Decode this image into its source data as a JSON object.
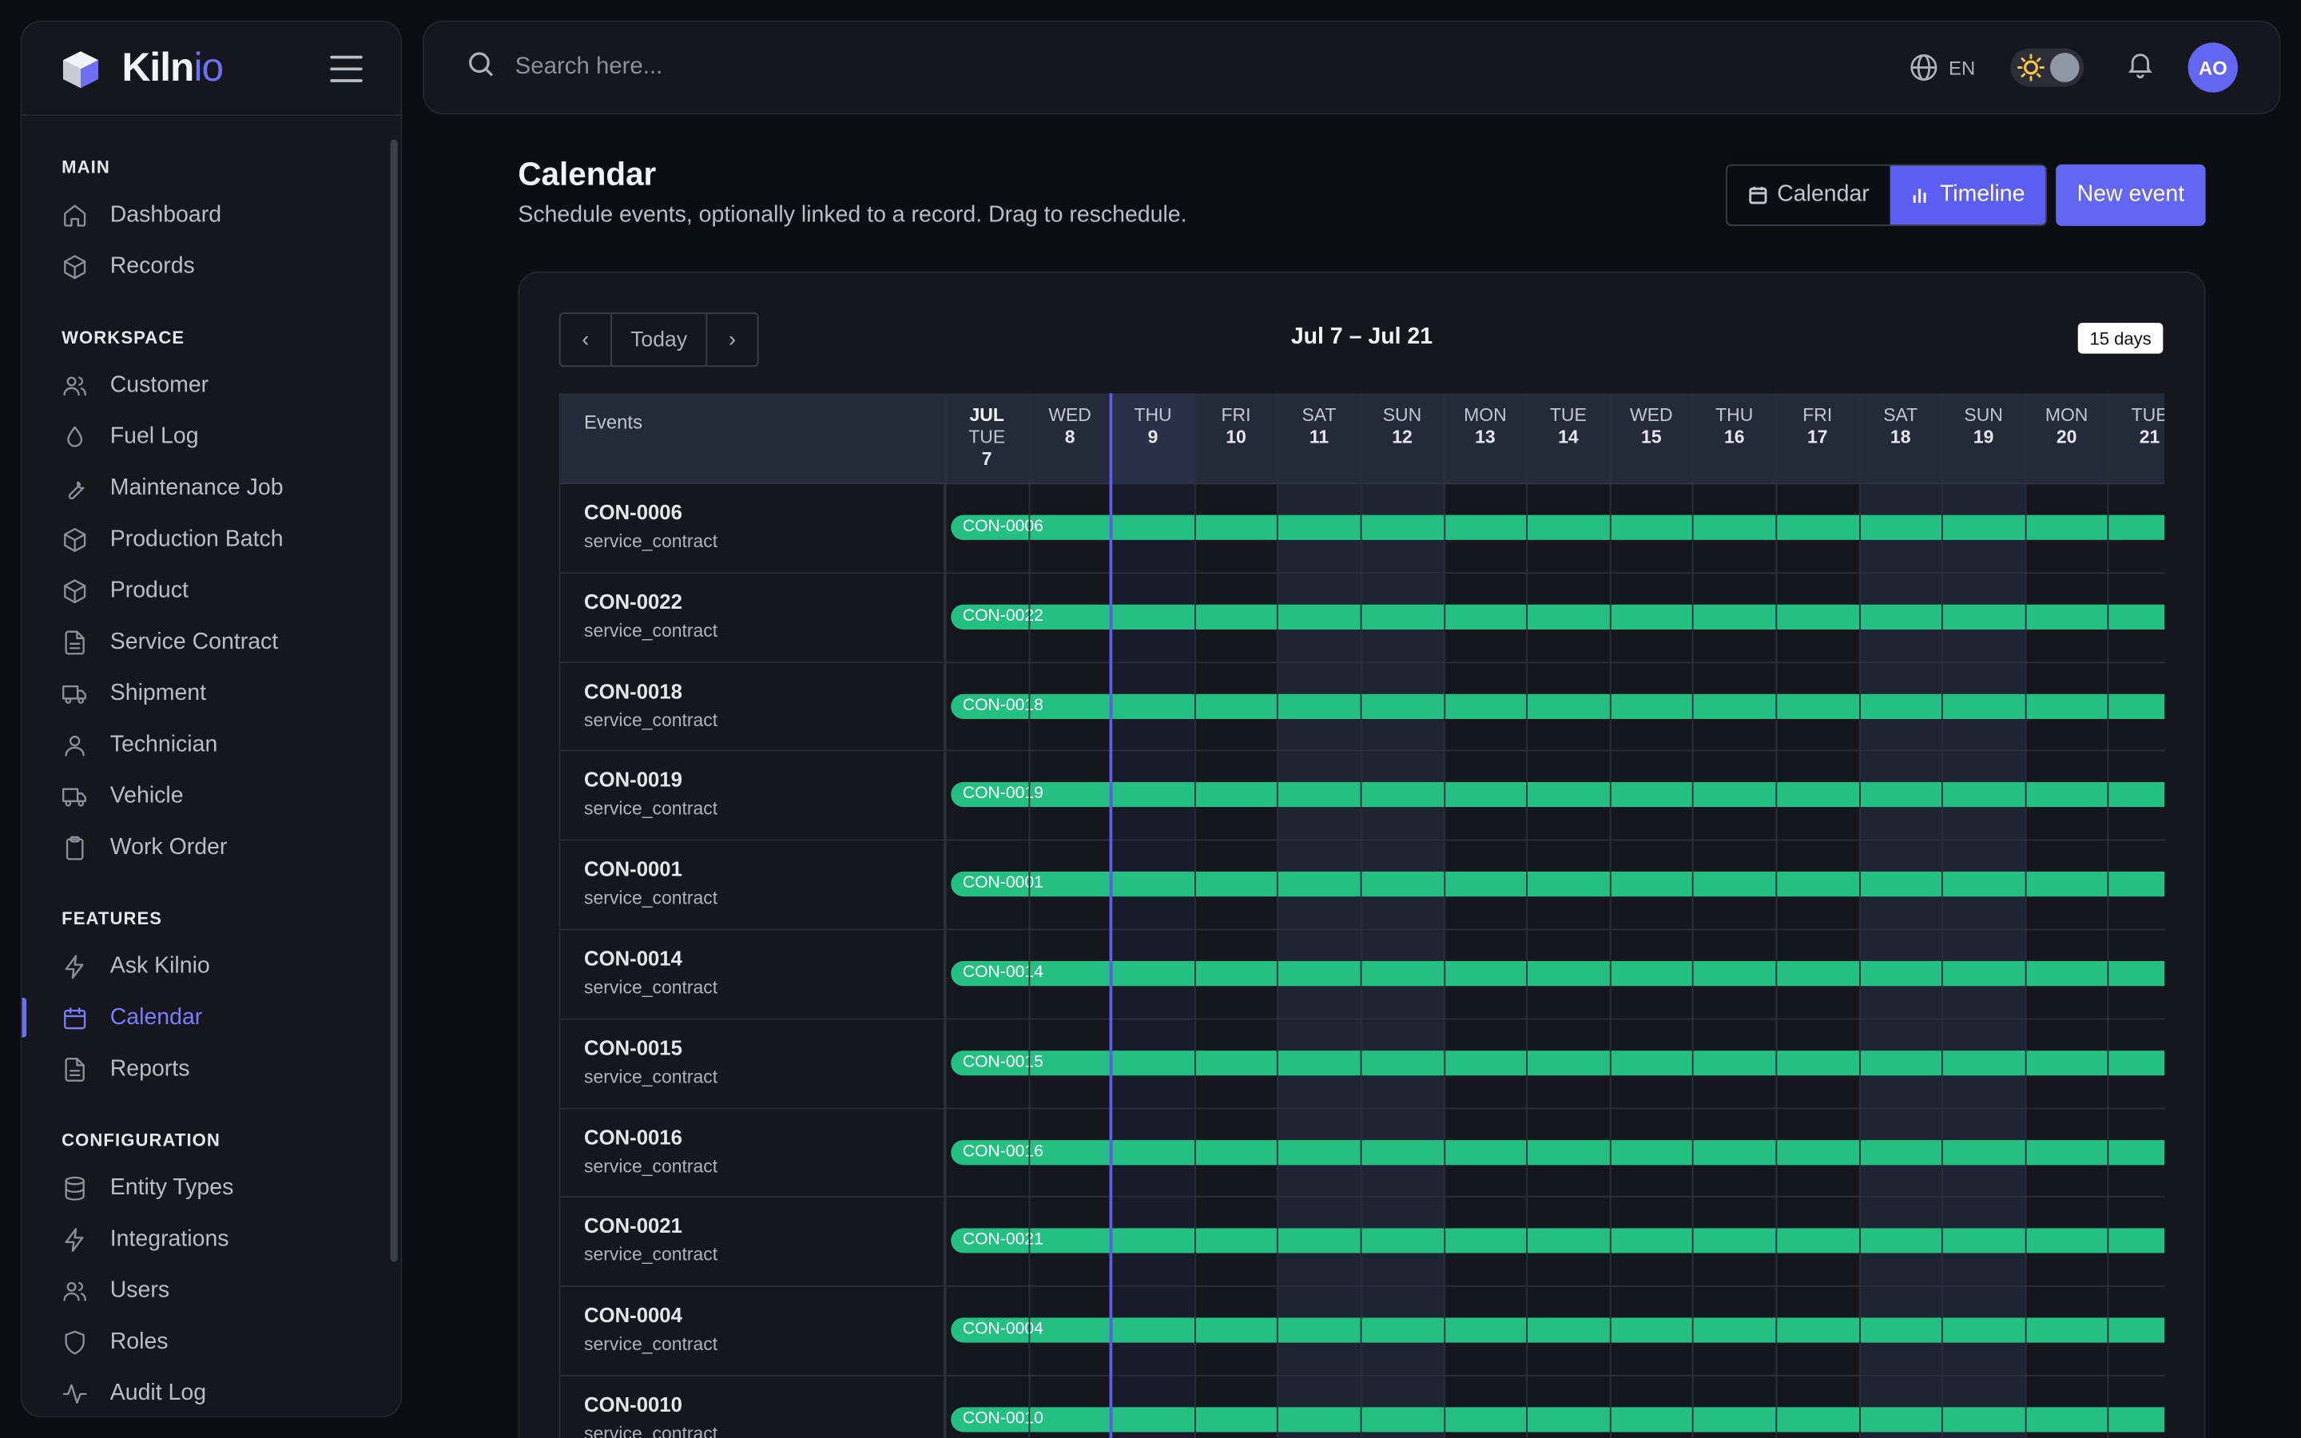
{
  "brand": {
    "name_main": "Kiln",
    "name_accent": "io"
  },
  "sidebar": {
    "sections": [
      {
        "title": "MAIN",
        "items": [
          {
            "label": "Dashboard",
            "icon": "home-icon"
          },
          {
            "label": "Records",
            "icon": "box-icon"
          }
        ]
      },
      {
        "title": "WORKSPACE",
        "items": [
          {
            "label": "Customer",
            "icon": "users-icon"
          },
          {
            "label": "Fuel Log",
            "icon": "droplet-icon"
          },
          {
            "label": "Maintenance Job",
            "icon": "wrench-icon"
          },
          {
            "label": "Production Batch",
            "icon": "box-icon"
          },
          {
            "label": "Product",
            "icon": "box-icon"
          },
          {
            "label": "Service Contract",
            "icon": "file-icon"
          },
          {
            "label": "Shipment",
            "icon": "truck-icon"
          },
          {
            "label": "Technician",
            "icon": "user-icon"
          },
          {
            "label": "Vehicle",
            "icon": "truck-icon"
          },
          {
            "label": "Work Order",
            "icon": "clipboard-icon"
          }
        ]
      },
      {
        "title": "FEATURES",
        "items": [
          {
            "label": "Ask Kilnio",
            "icon": "zap-icon"
          },
          {
            "label": "Calendar",
            "icon": "calendar-icon",
            "active": true
          },
          {
            "label": "Reports",
            "icon": "file-icon"
          }
        ]
      },
      {
        "title": "CONFIGURATION",
        "items": [
          {
            "label": "Entity Types",
            "icon": "database-icon"
          },
          {
            "label": "Integrations",
            "icon": "zap-icon"
          },
          {
            "label": "Users",
            "icon": "users-icon"
          },
          {
            "label": "Roles",
            "icon": "shield-icon"
          },
          {
            "label": "Audit Log",
            "icon": "activity-icon"
          }
        ]
      }
    ]
  },
  "topbar": {
    "search_placeholder": "Search here...",
    "language": "EN",
    "avatar_initials": "AO"
  },
  "page": {
    "title": "Calendar",
    "subtitle": "Schedule events, optionally linked to a record. Drag to reschedule.",
    "view_calendar": "Calendar",
    "view_timeline": "Timeline",
    "new_event": "New event"
  },
  "timeline": {
    "prev": "‹",
    "today": "Today",
    "next": "›",
    "range": "Jul 7 – Jul 21",
    "days_badge": "15 days",
    "events_header": "Events",
    "columns": [
      {
        "month": "JUL",
        "dow": "TUE",
        "day": "7"
      },
      {
        "dow": "WED",
        "day": "8"
      },
      {
        "dow": "THU",
        "day": "9",
        "today": true
      },
      {
        "dow": "FRI",
        "day": "10"
      },
      {
        "dow": "SAT",
        "day": "11",
        "weekend": true
      },
      {
        "dow": "SUN",
        "day": "12",
        "weekend": true
      },
      {
        "dow": "MON",
        "day": "13"
      },
      {
        "dow": "TUE",
        "day": "14"
      },
      {
        "dow": "WED",
        "day": "15"
      },
      {
        "dow": "THU",
        "day": "16"
      },
      {
        "dow": "FRI",
        "day": "17"
      },
      {
        "dow": "SAT",
        "day": "18",
        "weekend": true
      },
      {
        "dow": "SUN",
        "day": "19",
        "weekend": true
      },
      {
        "dow": "MON",
        "day": "20"
      },
      {
        "dow": "TUE",
        "day": "21"
      }
    ],
    "rows": [
      {
        "title": "CON-0006",
        "type": "service_contract",
        "bar": "CON-0006"
      },
      {
        "title": "CON-0022",
        "type": "service_contract",
        "bar": "CON-0022"
      },
      {
        "title": "CON-0018",
        "type": "service_contract",
        "bar": "CON-0018"
      },
      {
        "title": "CON-0019",
        "type": "service_contract",
        "bar": "CON-0019"
      },
      {
        "title": "CON-0001",
        "type": "service_contract",
        "bar": "CON-0001"
      },
      {
        "title": "CON-0014",
        "type": "service_contract",
        "bar": "CON-0014"
      },
      {
        "title": "CON-0015",
        "type": "service_contract",
        "bar": "CON-0015"
      },
      {
        "title": "CON-0016",
        "type": "service_contract",
        "bar": "CON-0016"
      },
      {
        "title": "CON-0021",
        "type": "service_contract",
        "bar": "CON-0021"
      },
      {
        "title": "CON-0004",
        "type": "service_contract",
        "bar": "CON-0004"
      },
      {
        "title": "CON-0010",
        "type": "service_contract",
        "bar": "CON-0010"
      }
    ]
  },
  "colors": {
    "accent": "#6366f1",
    "bar": "#23c082",
    "weekend": "#1e2433"
  }
}
